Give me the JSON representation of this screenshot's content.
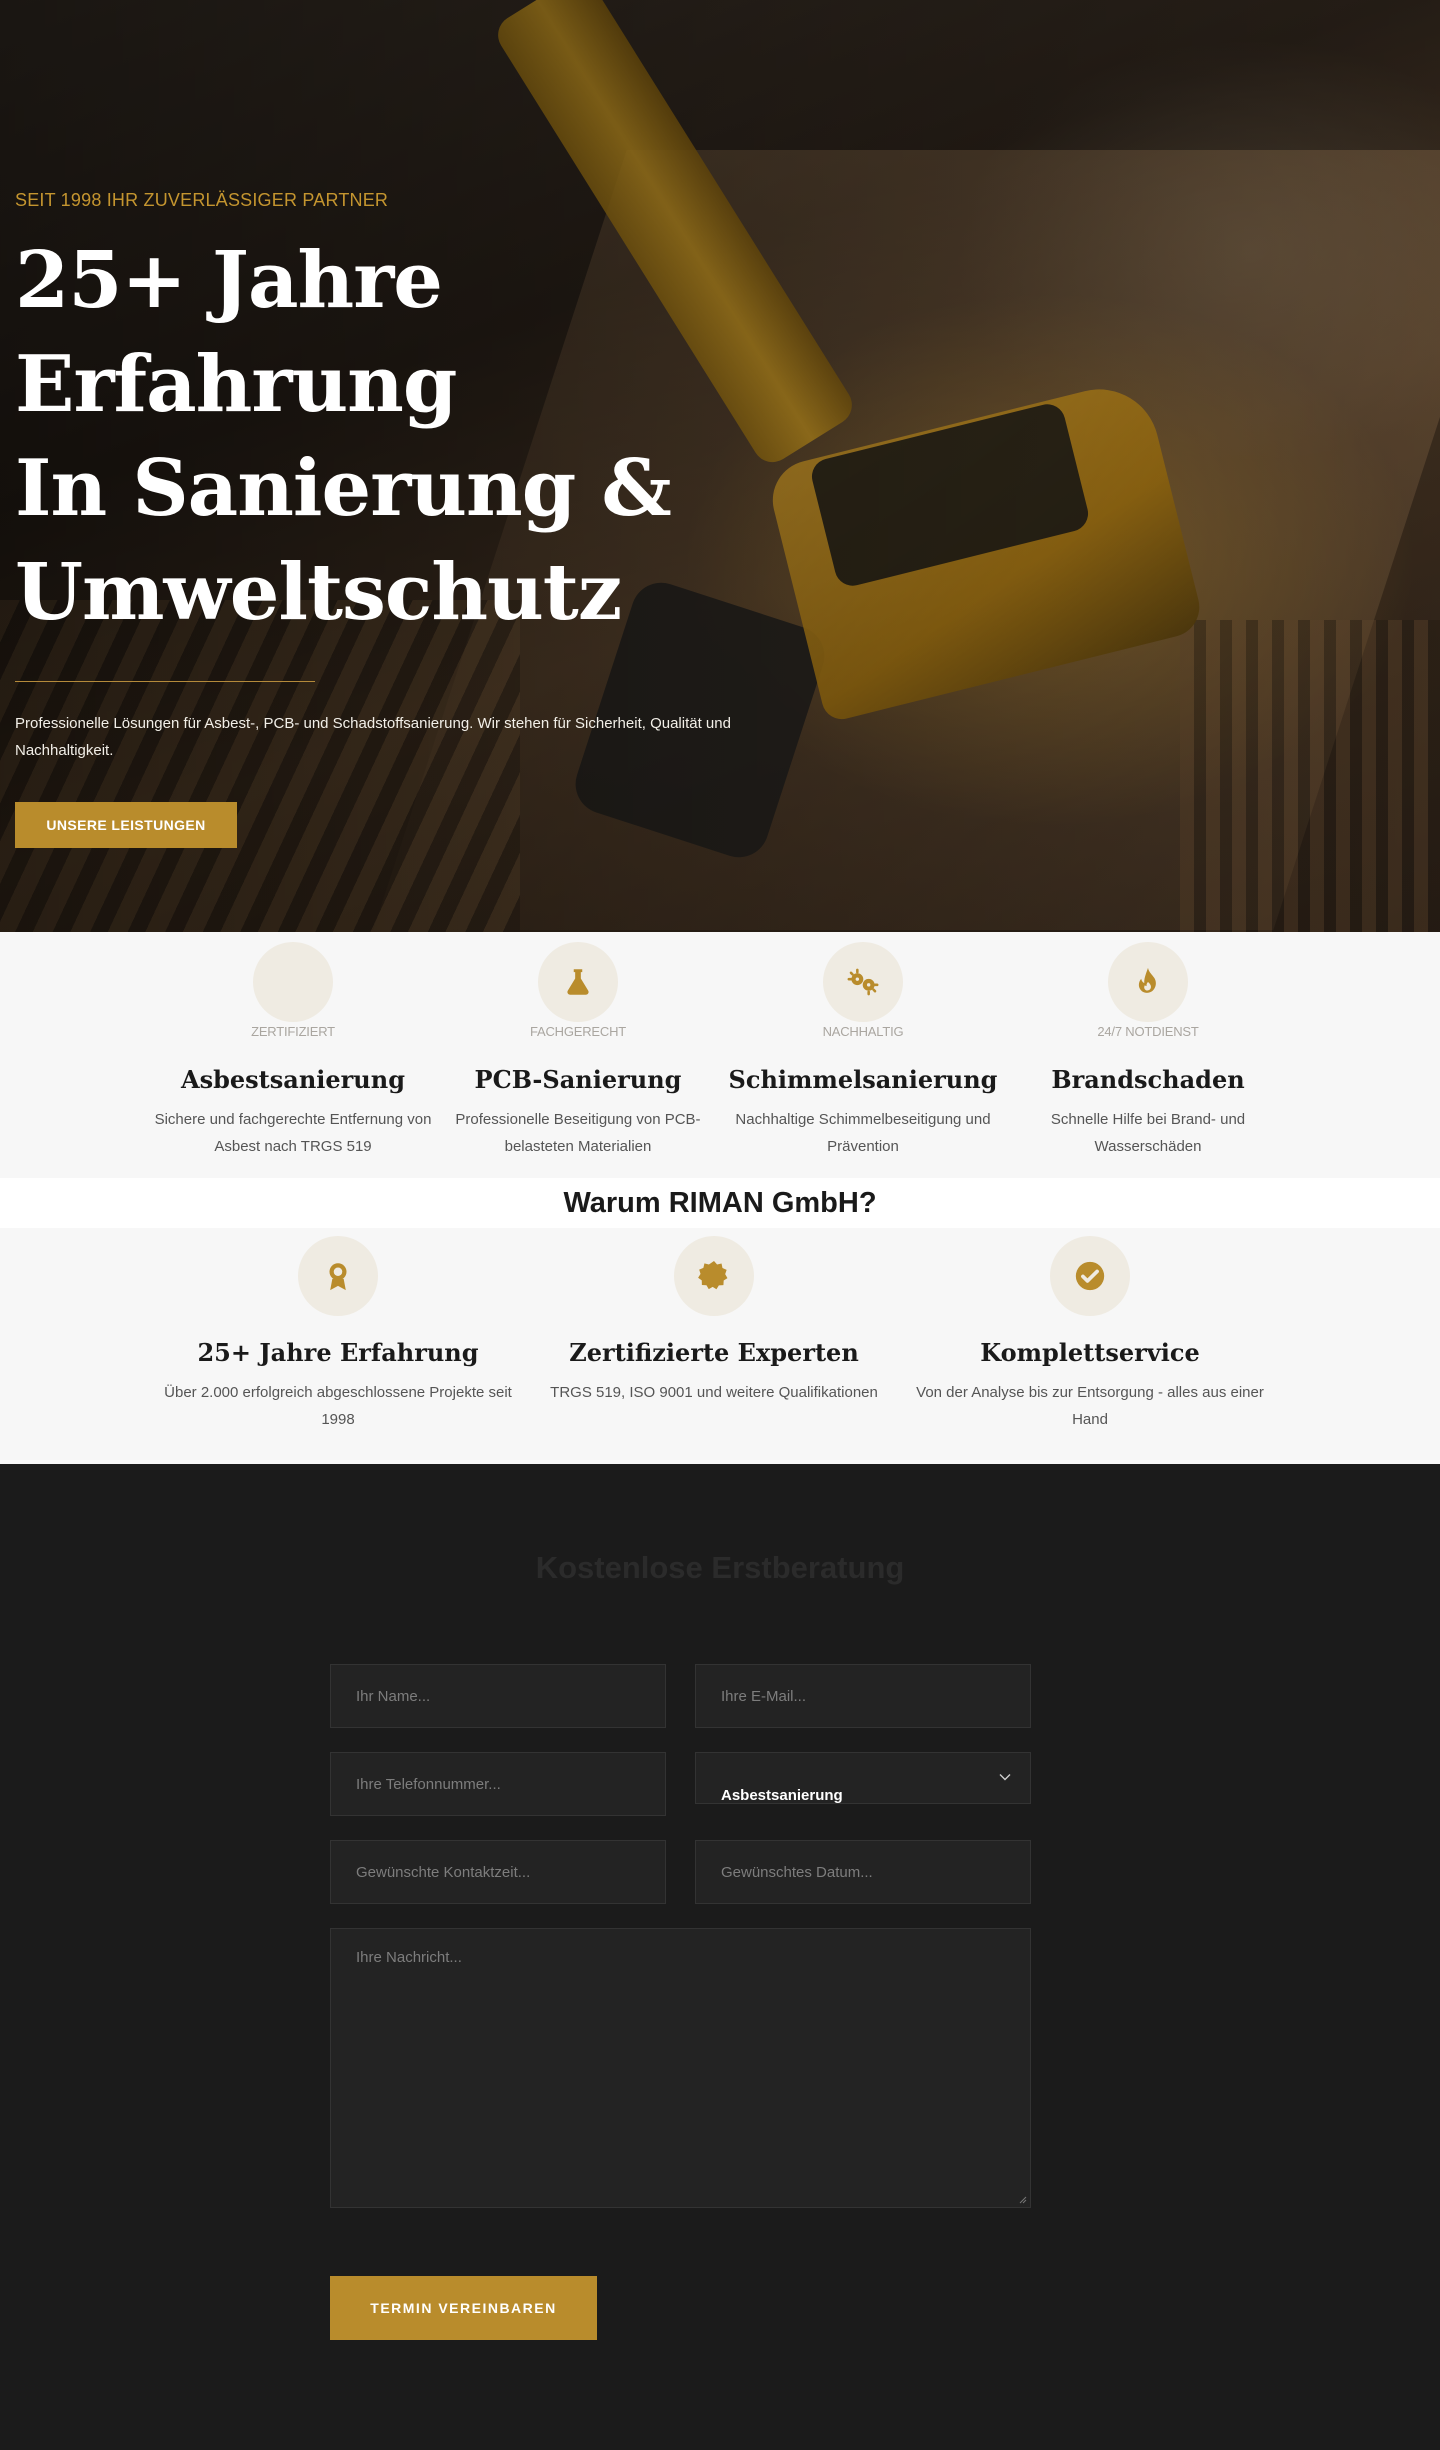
{
  "colors": {
    "accent": "#b98c2c",
    "dark_bg": "#1b1b1b",
    "light_bg": "#f7f7f7",
    "icon_circle": "#efebe2"
  },
  "hero": {
    "eyebrow": "SEIT 1998 IHR ZUVERLÄSSIGER PARTNER",
    "title_line1": "25+ Jahre Erfahrung",
    "title_line2": "In Sanierung &",
    "title_line3": "Umweltschutz",
    "description": "Professionelle Lösungen für Asbest-, PCB- und Schadstoffsanierung. Wir stehen für Sicherheit, Qualität und Nachhaltigkeit.",
    "button_label": "UNSERE LEISTUNGEN"
  },
  "services": [
    {
      "icon": "award-icon",
      "tag": "ZERTIFIZIERT",
      "title": "Asbestsanierung",
      "description": "Sichere und fachgerechte Entfernung von Asbest nach TRGS 519"
    },
    {
      "icon": "flask-icon",
      "tag": "FACHGERECHT",
      "title": "PCB-Sanierung",
      "description": "Professionelle Beseitigung von PCB-belasteten Materialien"
    },
    {
      "icon": "virus-icon",
      "tag": "NACHHALTIG",
      "title": "Schimmelsanierung",
      "description": "Nachhaltige Schimmelbeseitigung und Prävention"
    },
    {
      "icon": "fire-icon",
      "tag": "24/7 NOTDIENST",
      "title": "Brandschaden",
      "description": "Schnelle Hilfe bei Brand- und Wasserschäden"
    }
  ],
  "why": {
    "title": "Warum RIMAN GmbH?",
    "items": [
      {
        "icon": "medal-icon",
        "title": "25+ Jahre Erfahrung",
        "description": "Über 2.000 erfolgreich abgeschlossene Projekte seit 1998"
      },
      {
        "icon": "certificate-icon",
        "title": "Zertifizierte Experten",
        "description": "TRGS 519, ISO 9001 und weitere Qualifikationen"
      },
      {
        "icon": "check-circle-icon",
        "title": "Komplettservice",
        "description": "Von der Analyse bis zur Entsorgung - alles aus einer Hand"
      }
    ]
  },
  "contact": {
    "title": "Kostenlose Erstberatung",
    "name_placeholder": "Ihr Name...",
    "email_placeholder": "Ihre E-Mail...",
    "phone_placeholder": "Ihre Telefonnummer...",
    "service_selected": "Asbestsanierung",
    "time_placeholder": "Gewünschte Kontaktzeit...",
    "date_placeholder": "Gewünschtes Datum...",
    "message_placeholder": "Ihre Nachricht...",
    "submit_label": "TERMIN VEREINBAREN"
  }
}
